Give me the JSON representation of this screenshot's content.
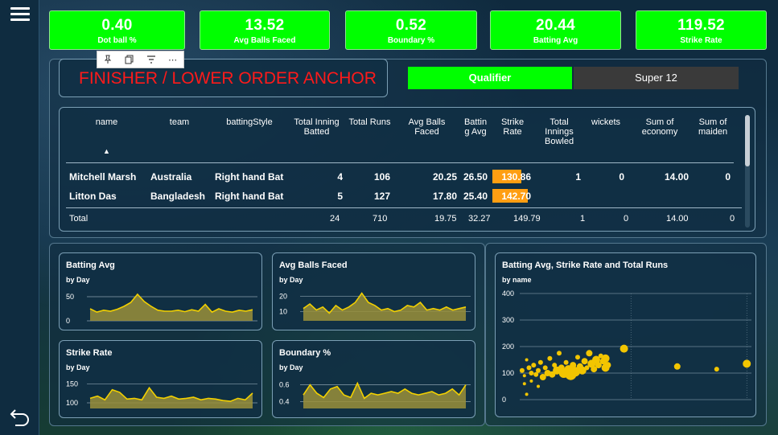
{
  "kpis": [
    {
      "value": "0.40",
      "label": "Dot ball %"
    },
    {
      "value": "13.52",
      "label": "Avg Balls Faced"
    },
    {
      "value": "0.52",
      "label": "Boundary %"
    },
    {
      "value": "20.44",
      "label": "Batting Avg"
    },
    {
      "value": "119.52",
      "label": "Strike Rate"
    }
  ],
  "page_title": "FINISHER / LOWER ORDER ANCHOR",
  "tabs": {
    "active": "Qualifier",
    "other": "Super 12"
  },
  "visual_toolbar": {
    "icons": [
      "pin-icon",
      "copy-icon",
      "filter-icon",
      "more-options-icon"
    ],
    "more_label": "⋯"
  },
  "table": {
    "columns": [
      "name",
      "team",
      "battingStyle",
      "Total Inning Batted",
      "Total Runs",
      "Avg Balls Faced",
      "Battin g Avg",
      "Strike Rate",
      "Total Innings Bowled",
      "wickets",
      "Sum of economy",
      "Sum of maiden"
    ],
    "sort_indicator": "▲",
    "rows": [
      [
        "Mitchell Marsh",
        "Australia",
        "Right hand Bat",
        "4",
        "106",
        "20.25",
        "26.50",
        "130.86",
        "1",
        "0",
        "14.00",
        "0"
      ],
      [
        "Litton Das",
        "Bangladesh",
        "Right hand Bat",
        "5",
        "127",
        "17.80",
        "25.40",
        "142.70",
        "",
        "",
        "",
        ""
      ]
    ],
    "strike_rate_fill": [
      0.62,
      0.76
    ],
    "total": {
      "label": "Total",
      "innings": "24",
      "runs": "710",
      "balls": "19.75",
      "avg": "32.27",
      "sr": "149.79",
      "bowled": "1",
      "wkts": "0",
      "econ": "14.00",
      "maiden": "0"
    }
  },
  "small_charts": [
    {
      "title": "Batting Avg",
      "subtitle": "by Day",
      "ticks": [
        "50",
        "0"
      ],
      "tick_values": [
        50,
        0
      ],
      "ymax": 70,
      "values": [
        25,
        18,
        22,
        20,
        24,
        30,
        38,
        55,
        40,
        30,
        22,
        20,
        20,
        22,
        19,
        23,
        20,
        34,
        18,
        25,
        20,
        18,
        22,
        20,
        23
      ]
    },
    {
      "title": "Avg Balls Faced",
      "subtitle": "by Day",
      "ticks": [
        "20",
        "10"
      ],
      "tick_values": [
        20,
        10
      ],
      "ymax": 26,
      "ymin": 4,
      "values": [
        12,
        15,
        11,
        13,
        9,
        14,
        11,
        13,
        16,
        22,
        16,
        14,
        11,
        12,
        10,
        11,
        14,
        13,
        16,
        11,
        12,
        11,
        13,
        11,
        12,
        13
      ]
    },
    {
      "title": "Strike Rate",
      "subtitle": "by Day",
      "ticks": [
        "150",
        "100"
      ],
      "tick_values": [
        150,
        100
      ],
      "ymax": 175,
      "ymin": 85,
      "values": [
        112,
        118,
        108,
        135,
        128,
        110,
        112,
        108,
        140,
        115,
        112,
        118,
        110,
        112,
        115,
        108,
        112,
        110,
        106,
        104,
        112,
        108,
        126
      ]
    },
    {
      "title": "Boundary %",
      "subtitle": "by Day",
      "ticks": [
        "0.6",
        "0.4"
      ],
      "tick_values": [
        0.6,
        0.4
      ],
      "ymax": 0.72,
      "ymin": 0.32,
      "values": [
        0.48,
        0.6,
        0.5,
        0.45,
        0.55,
        0.58,
        0.48,
        0.45,
        0.62,
        0.44,
        0.5,
        0.48,
        0.5,
        0.52,
        0.5,
        0.55,
        0.5,
        0.48,
        0.5,
        0.52,
        0.48,
        0.5,
        0.55,
        0.48,
        0.6
      ]
    }
  ],
  "chart_data": [
    {
      "type": "scatter",
      "title": "Batting Avg, Strike Rate and Total Runs",
      "subtitle": "by name",
      "ylim": [
        0,
        400
      ],
      "yticks": [
        "400",
        "300",
        "200",
        "100",
        "0"
      ],
      "xlim": [
        0,
        100
      ],
      "color": "#f2c500",
      "points": [
        {
          "x": 1,
          "y": 110,
          "s": 3
        },
        {
          "x": 2,
          "y": 90,
          "s": 2
        },
        {
          "x": 2,
          "y": 60,
          "s": 2
        },
        {
          "x": 3,
          "y": 20,
          "s": 2
        },
        {
          "x": 3,
          "y": 150,
          "s": 2
        },
        {
          "x": 4,
          "y": 120,
          "s": 3
        },
        {
          "x": 5,
          "y": 100,
          "s": 3
        },
        {
          "x": 5,
          "y": 70,
          "s": 2
        },
        {
          "x": 6,
          "y": 130,
          "s": 3
        },
        {
          "x": 7,
          "y": 95,
          "s": 3
        },
        {
          "x": 8,
          "y": 110,
          "s": 3
        },
        {
          "x": 8,
          "y": 50,
          "s": 2
        },
        {
          "x": 9,
          "y": 140,
          "s": 3
        },
        {
          "x": 10,
          "y": 85,
          "s": 4
        },
        {
          "x": 11,
          "y": 120,
          "s": 3
        },
        {
          "x": 12,
          "y": 100,
          "s": 4
        },
        {
          "x": 13,
          "y": 155,
          "s": 3
        },
        {
          "x": 14,
          "y": 95,
          "s": 4
        },
        {
          "x": 15,
          "y": 130,
          "s": 3
        },
        {
          "x": 16,
          "y": 110,
          "s": 5
        },
        {
          "x": 17,
          "y": 175,
          "s": 3
        },
        {
          "x": 18,
          "y": 120,
          "s": 4
        },
        {
          "x": 19,
          "y": 100,
          "s": 6
        },
        {
          "x": 20,
          "y": 140,
          "s": 3
        },
        {
          "x": 21,
          "y": 115,
          "s": 5
        },
        {
          "x": 22,
          "y": 95,
          "s": 7
        },
        {
          "x": 23,
          "y": 130,
          "s": 4
        },
        {
          "x": 24,
          "y": 105,
          "s": 6
        },
        {
          "x": 25,
          "y": 160,
          "s": 3
        },
        {
          "x": 26,
          "y": 125,
          "s": 4
        },
        {
          "x": 27,
          "y": 110,
          "s": 5
        },
        {
          "x": 28,
          "y": 145,
          "s": 4
        },
        {
          "x": 29,
          "y": 120,
          "s": 3
        },
        {
          "x": 30,
          "y": 175,
          "s": 4
        },
        {
          "x": 31,
          "y": 135,
          "s": 5
        },
        {
          "x": 32,
          "y": 115,
          "s": 4
        },
        {
          "x": 33,
          "y": 150,
          "s": 5
        },
        {
          "x": 34,
          "y": 130,
          "s": 4
        },
        {
          "x": 35,
          "y": 165,
          "s": 3
        },
        {
          "x": 36,
          "y": 145,
          "s": 4
        },
        {
          "x": 37,
          "y": 120,
          "s": 5
        },
        {
          "x": 37,
          "y": 155,
          "s": 5
        },
        {
          "x": 38,
          "y": 130,
          "s": 4
        },
        {
          "x": 45,
          "y": 192,
          "s": 5
        },
        {
          "x": 68,
          "y": 125,
          "s": 4
        },
        {
          "x": 85,
          "y": 115,
          "s": 3
        },
        {
          "x": 98,
          "y": 135,
          "s": 5
        }
      ]
    }
  ]
}
